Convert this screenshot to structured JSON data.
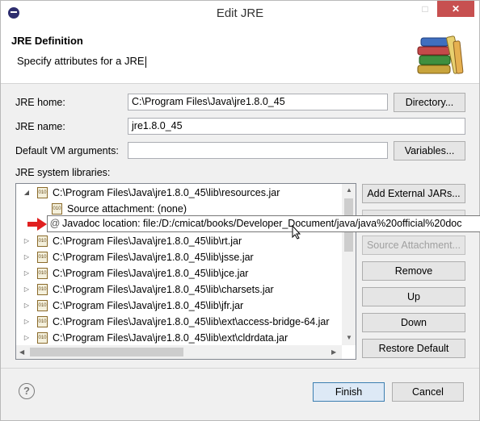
{
  "window": {
    "title": "Edit JRE",
    "close_glyph": "✕",
    "maximize_glyph": "□"
  },
  "header": {
    "title": "JRE Definition",
    "message": "Specify attributes for a JRE",
    "image_icon": "books-icon"
  },
  "form": {
    "jre_home_label": "JRE home:",
    "jre_home_value": "C:\\Program Files\\Java\\jre1.8.0_45",
    "directory_button": "Directory...",
    "jre_name_label": "JRE name:",
    "jre_name_value": "jre1.8.0_45",
    "vm_args_label": "Default VM arguments:",
    "vm_args_value": "",
    "variables_button": "Variables...",
    "libraries_label": "JRE system libraries:"
  },
  "libraries": {
    "expanded": {
      "path": "C:\\Program Files\\Java\\jre1.8.0_45\\lib\\resources.jar",
      "source_attachment": "Source attachment: (none)",
      "javadoc_location": "Javadoc location: file:/D:/cmicat/books/Developer_Document/java/java%20official%20doc"
    },
    "items": [
      "C:\\Program Files\\Java\\jre1.8.0_45\\lib\\rt.jar",
      "C:\\Program Files\\Java\\jre1.8.0_45\\lib\\jsse.jar",
      "C:\\Program Files\\Java\\jre1.8.0_45\\lib\\jce.jar",
      "C:\\Program Files\\Java\\jre1.8.0_45\\lib\\charsets.jar",
      "C:\\Program Files\\Java\\jre1.8.0_45\\lib\\jfr.jar",
      "C:\\Program Files\\Java\\jre1.8.0_45\\lib\\ext\\access-bridge-64.jar",
      "C:\\Program Files\\Java\\jre1.8.0_45\\lib\\ext\\cldrdata.jar"
    ],
    "jar_glyph": "010"
  },
  "side_buttons": {
    "add_external_jars": "Add External JARs...",
    "source_attachment": "Source Attachment...",
    "remove": "Remove",
    "up": "Up",
    "down": "Down",
    "restore_default": "Restore Default"
  },
  "footer": {
    "help_glyph": "?",
    "finish": "Finish",
    "cancel": "Cancel"
  },
  "glyphs": {
    "expanded": "◢",
    "collapsed": "▷",
    "at": "@",
    "left": "◀",
    "right": "▶",
    "up": "▲",
    "down": "▼"
  },
  "colors": {
    "close_button": "#c75050",
    "arrow": "#e02020",
    "default_button_border": "#3c7fb1"
  }
}
